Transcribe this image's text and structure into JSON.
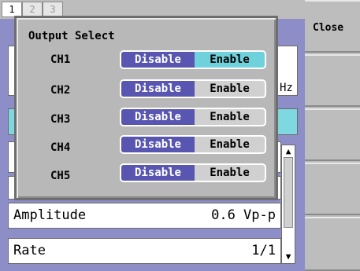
{
  "tabs": [
    {
      "label": "1",
      "active": true
    },
    {
      "label": "2",
      "active": false
    },
    {
      "label": "3",
      "active": false
    }
  ],
  "softkeys": {
    "close_label": "Close"
  },
  "background_panel": {
    "unit_fragment": "Hz",
    "rows": [
      {
        "label": "Amplitude",
        "value": "0.6 Vp-p"
      },
      {
        "label": "Rate",
        "value": "1/1"
      }
    ]
  },
  "dialog": {
    "title": "Output Select",
    "channels": [
      {
        "label": "CH1",
        "disable_label": "Disable",
        "enable_label": "Enable",
        "state": "Enable"
      },
      {
        "label": "CH2",
        "disable_label": "Disable",
        "enable_label": "Enable",
        "state": "Disable"
      },
      {
        "label": "CH3",
        "disable_label": "Disable",
        "enable_label": "Enable",
        "state": "Disable"
      },
      {
        "label": "CH4",
        "disable_label": "Disable",
        "enable_label": "Enable",
        "state": "Disable"
      },
      {
        "label": "CH5",
        "disable_label": "Disable",
        "enable_label": "Enable",
        "state": "Disable"
      }
    ]
  },
  "colors": {
    "selected_disable": "#5856b0",
    "selected_enable": "#6fd1dc",
    "panel": "#8d8ec8"
  }
}
